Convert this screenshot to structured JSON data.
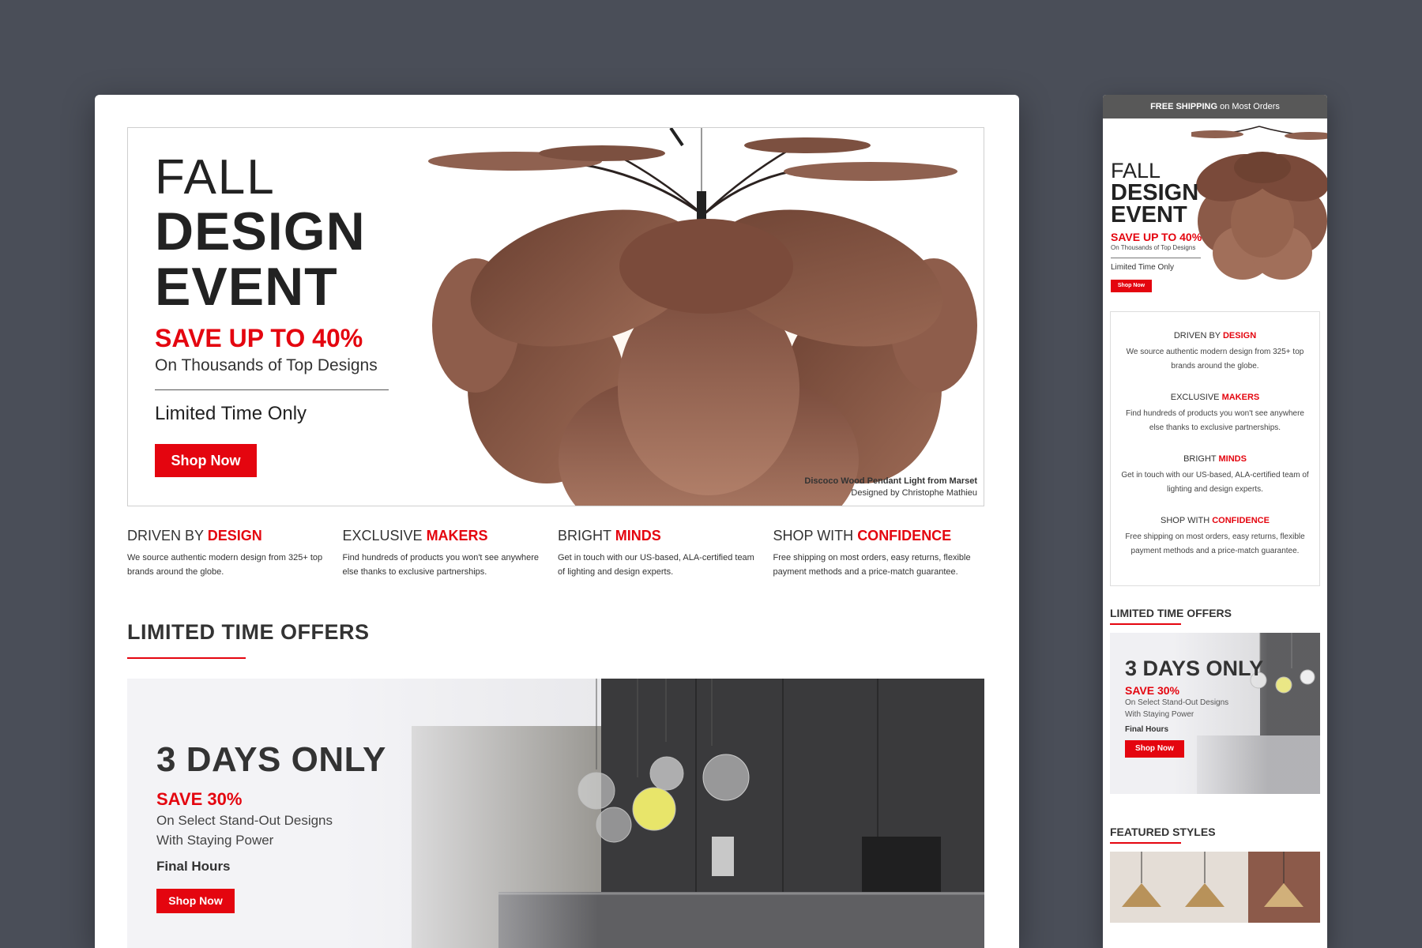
{
  "desktop": {
    "hero": {
      "line1": "FALL",
      "line2": "DESIGN",
      "line3": "EVENT",
      "save": "SAVE UP TO 40%",
      "sub": "On Thousands of Top Designs",
      "limited": "Limited Time Only",
      "cta": "Shop Now",
      "caption1": "Discoco Wood Pendant Light from Marset",
      "caption2": "Designed by Christophe Mathieu"
    },
    "features": [
      {
        "pre": "DRIVEN BY",
        "hl": "DESIGN",
        "desc": "We source authentic modern design from 325+ top brands around the globe."
      },
      {
        "pre": "EXCLUSIVE",
        "hl": "MAKERS",
        "desc": "Find hundreds of products you won't see anywhere else thanks to exclusive partnerships."
      },
      {
        "pre": "BRIGHT",
        "hl": "MINDS",
        "desc": "Get in touch with our US-based, ALA-certified team of lighting and design experts."
      },
      {
        "pre": "SHOP WITH",
        "hl": "CONFIDENCE",
        "desc": "Free shipping on most orders, easy returns, flexible payment methods and a price-match guarantee."
      }
    ],
    "offers_title": "LIMITED TIME OFFERS",
    "promo": {
      "title": "3 DAYS ONLY",
      "save": "SAVE 30%",
      "sub1": "On Select Stand-Out Designs",
      "sub2": "With Staying Power",
      "final": "Final Hours",
      "cta": "Shop Now"
    }
  },
  "mobile": {
    "shipping_bold": "FREE SHIPPING",
    "shipping_rest": " on Most Orders",
    "hero": {
      "line1": "FALL",
      "line2": "DESIGN",
      "line3": "EVENT",
      "save": "SAVE UP TO 40%",
      "sub": "On Thousands of Top Designs",
      "limited": "Limited Time Only",
      "cta": "Shop Now"
    },
    "features": [
      {
        "pre": "DRIVEN BY",
        "hl": "DESIGN",
        "desc": "We source authentic modern design from 325+ top brands around the globe."
      },
      {
        "pre": "EXCLUSIVE",
        "hl": "MAKERS",
        "desc": "Find hundreds of products you won't see anywhere else thanks to exclusive partnerships."
      },
      {
        "pre": "BRIGHT",
        "hl": "MINDS",
        "desc": "Get in touch with our US-based, ALA-certified team of lighting and design experts."
      },
      {
        "pre": "SHOP WITH",
        "hl": "CONFIDENCE",
        "desc": "Free shipping on most orders, easy returns, flexible payment methods and a price-match guarantee."
      }
    ],
    "offers_title": "LIMITED TIME OFFERS",
    "promo": {
      "title": "3 DAYS ONLY",
      "save": "SAVE 30%",
      "sub1": "On Select Stand-Out Designs",
      "sub2": "With Staying Power",
      "final": "Final Hours",
      "cta": "Shop Now"
    },
    "featured_title": "FEATURED STYLES"
  },
  "colors": {
    "accent": "#e4050f",
    "background": "#4a4e58",
    "wood": "#8a5a4a",
    "shipping_bar": "#585858"
  }
}
